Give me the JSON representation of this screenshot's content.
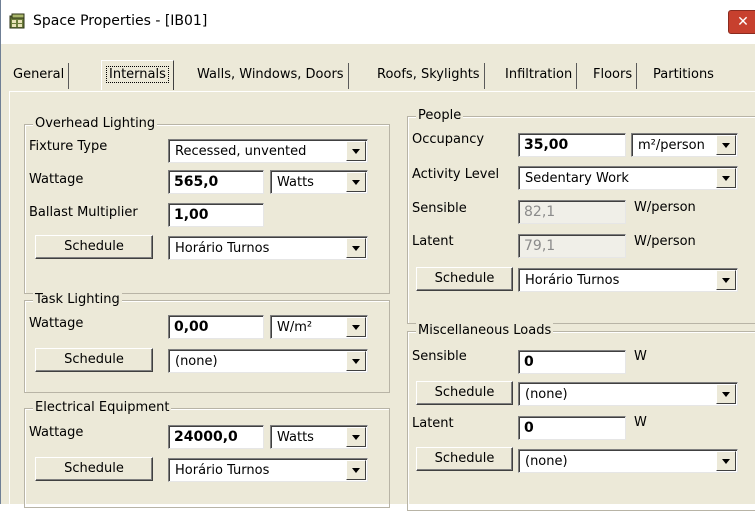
{
  "window": {
    "title": "Space Properties - [IB01]",
    "close_glyph": "✕"
  },
  "tabs": [
    {
      "label": "General",
      "active": false
    },
    {
      "label": "Internals",
      "active": true
    },
    {
      "label": "Walls, Windows, Doors",
      "active": false
    },
    {
      "label": "Roofs, Skylights",
      "active": false
    },
    {
      "label": "Infiltration",
      "active": false
    },
    {
      "label": "Floors",
      "active": false
    },
    {
      "label": "Partitions",
      "active": false
    }
  ],
  "overhead_lighting": {
    "legend": "Overhead Lighting",
    "fixture_type_label": "Fixture Type",
    "fixture_type_value": "Recessed, unvented",
    "wattage_label": "Wattage",
    "wattage_value": "565,0",
    "wattage_unit": "Watts",
    "ballast_label": "Ballast Multiplier",
    "ballast_value": "1,00",
    "schedule_button": "Schedule",
    "schedule_value": "Horário Turnos"
  },
  "task_lighting": {
    "legend": "Task Lighting",
    "wattage_label": "Wattage",
    "wattage_value": "0,00",
    "wattage_unit": "W/m²",
    "schedule_button": "Schedule",
    "schedule_value": "(none)"
  },
  "electrical_equipment": {
    "legend": "Electrical Equipment",
    "wattage_label": "Wattage",
    "wattage_value": "24000,0",
    "wattage_unit": "Watts",
    "schedule_button": "Schedule",
    "schedule_value": "Horário Turnos"
  },
  "people": {
    "legend": "People",
    "occupancy_label": "Occupancy",
    "occupancy_value": "35,00",
    "occupancy_unit": "m²/person",
    "activity_label": "Activity Level",
    "activity_value": "Sedentary Work",
    "sensible_label": "Sensible",
    "sensible_value": "82,1",
    "sensible_unit": "W/person",
    "latent_label": "Latent",
    "latent_value": "79,1",
    "latent_unit": "W/person",
    "schedule_button": "Schedule",
    "schedule_value": "Horário Turnos"
  },
  "misc_loads": {
    "legend": "Miscellaneous Loads",
    "sensible_label": "Sensible",
    "sensible_value": "0",
    "sensible_unit": "W",
    "sensible_schedule_button": "Schedule",
    "sensible_schedule_value": "(none)",
    "latent_label": "Latent",
    "latent_value": "0",
    "latent_unit": "W",
    "latent_schedule_button": "Schedule",
    "latent_schedule_value": "(none)"
  },
  "icons": {
    "title_icon": "space-properties-icon",
    "dropdown": "chevron-down-icon"
  }
}
